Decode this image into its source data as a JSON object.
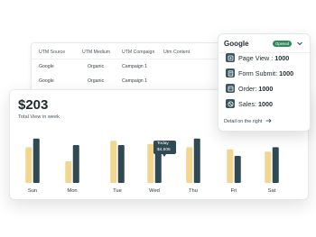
{
  "utm_table": {
    "headers": [
      "UTM Source",
      "UTM Medium",
      "UTM Compaign",
      "Utm Content"
    ],
    "rows": [
      [
        "Google",
        "Organic",
        "Campaign 1",
        ""
      ],
      [
        "Google",
        "Organic",
        "Campaign 1",
        ""
      ]
    ]
  },
  "dashboard": {
    "amount": "$203",
    "subtitle": "Total View in week",
    "tooltip": {
      "line1": "Today",
      "line2": "$4,505"
    },
    "colors": {
      "light_bar": "#f2d58e",
      "dark_bar": "#2f4a52"
    }
  },
  "chart_data": {
    "type": "bar",
    "categories": [
      "Sun",
      "Mon",
      "Tue",
      "Wed",
      "Thu",
      "Fri",
      "Sat"
    ],
    "series": [
      {
        "values": [
          33,
          20,
          39,
          36,
          33,
          31,
          29
        ]
      },
      {
        "values": [
          41,
          35,
          35,
          36,
          41,
          25,
          33
        ]
      }
    ],
    "ylim": [
      0,
      50
    ],
    "grid": false
  },
  "google_panel": {
    "title": "Google",
    "badge": "Opened",
    "chevron_icon": "chevron-down-icon",
    "metrics": [
      {
        "icon": "page-view-icon",
        "label": "Page View :",
        "value": "1000"
      },
      {
        "icon": "form-submit-icon",
        "label": "Form Submit:",
        "value": "1000"
      },
      {
        "icon": "order-icon",
        "label": "Order:",
        "value": "1000"
      },
      {
        "icon": "sales-icon",
        "label": "Sales:",
        "value": "1000"
      }
    ],
    "detail_link": "Detail on the right",
    "arrow_icon": "arrow-right-icon"
  }
}
